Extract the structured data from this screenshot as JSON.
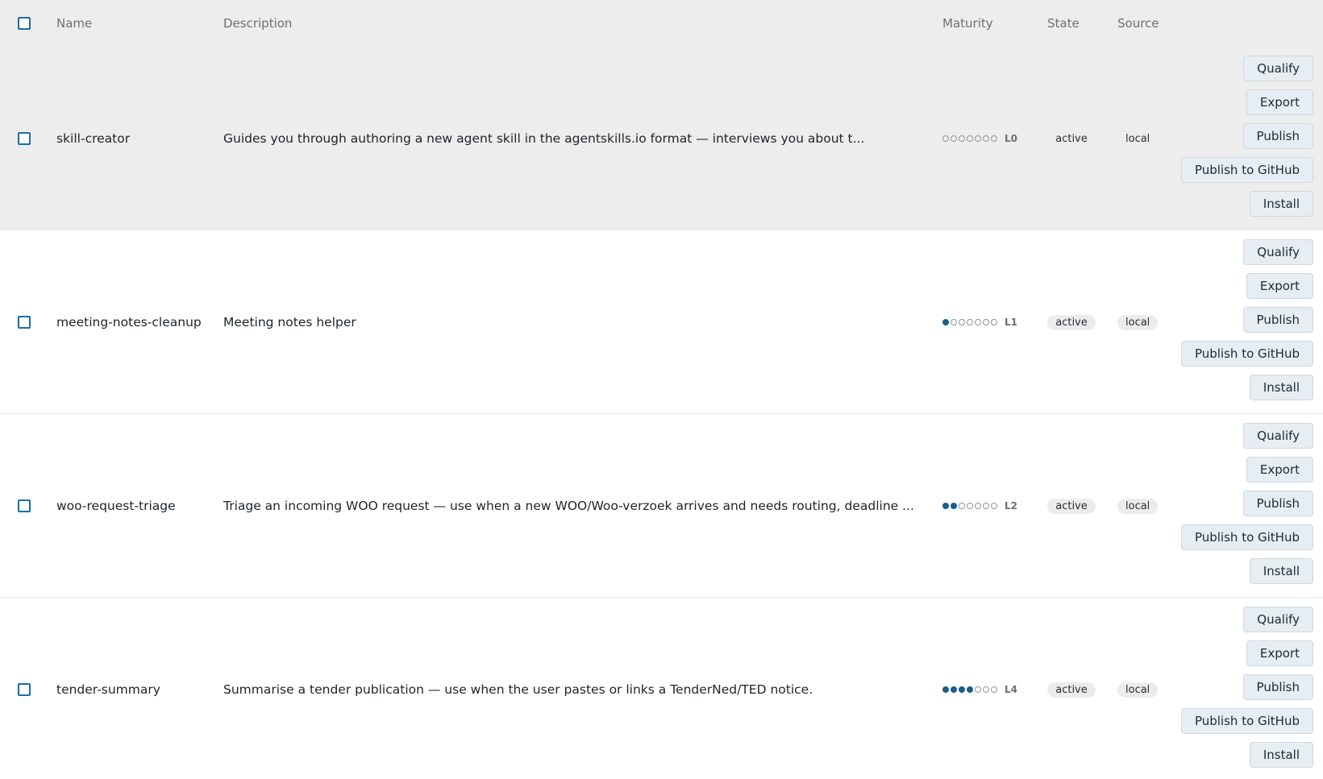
{
  "header": {
    "name": "Name",
    "description": "Description",
    "maturity": "Maturity",
    "state": "State",
    "source": "Source"
  },
  "actions": {
    "qualify": "Qualify",
    "export": "Export",
    "publish": "Publish",
    "publish_github": "Publish to GitHub",
    "install": "Install"
  },
  "rows": [
    {
      "name": "skill-creator",
      "description": "Guides you through authoring a new agent skill in the agentskills.io format — interviews you about t...",
      "maturity_filled": 0,
      "maturity_total": 7,
      "maturity_label": "L0",
      "state": "active",
      "source": "local"
    },
    {
      "name": "meeting-notes-cleanup",
      "description": "Meeting notes helper",
      "maturity_filled": 1,
      "maturity_total": 7,
      "maturity_label": "L1",
      "state": "active",
      "source": "local"
    },
    {
      "name": "woo-request-triage",
      "description": "Triage an incoming WOO request — use when a new WOO/Woo-verzoek arrives and needs routing, deadline ...",
      "maturity_filled": 2,
      "maturity_total": 7,
      "maturity_label": "L2",
      "state": "active",
      "source": "local"
    },
    {
      "name": "tender-summary",
      "description": "Summarise a tender publication — use when the user pastes or links a TenderNed/TED notice.",
      "maturity_filled": 4,
      "maturity_total": 7,
      "maturity_label": "L4",
      "state": "active",
      "source": "local"
    }
  ],
  "colors": {
    "accent": "#1b6fa6",
    "maturity_filled": "#1b5e8a",
    "hover_row": "#ededed",
    "button_bg": "#e6edf3"
  }
}
